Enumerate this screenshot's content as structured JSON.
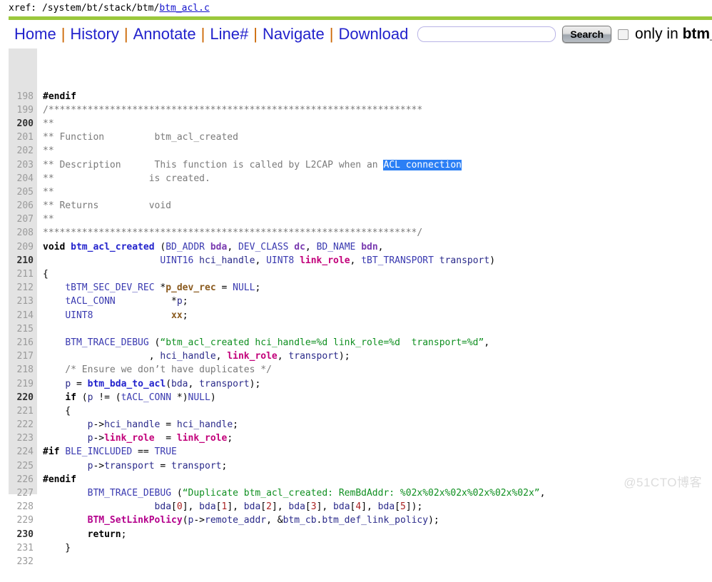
{
  "xref": {
    "label": "xref:",
    "path_plain": "/system/bt/stack/btm/",
    "path_link": "btm_acl.c"
  },
  "nav": {
    "links": [
      {
        "label": "Home"
      },
      {
        "label": "History"
      },
      {
        "label": "Annotate"
      },
      {
        "label": "Line#"
      },
      {
        "label": "Navigate"
      },
      {
        "label": "Download"
      }
    ],
    "separator": "|",
    "search_value": "",
    "search_placeholder": "",
    "search_button_label": "Search",
    "only_in_prefix": "only in ",
    "only_in_scope": "btm_",
    "checkbox_checked": false
  },
  "colors": {
    "green_bar": "#9bc83c",
    "nav_link": "#2222cc",
    "nav_separator": "#cc6600",
    "gutter_bg": "#e3e3e3",
    "selection_bg": "#2b7ff5",
    "string": "#0f8f20",
    "comment": "#7a7a7a",
    "function_blue": "#2222cc",
    "function_magenta": "#b4008c",
    "number": "#aa2222"
  },
  "code": {
    "first_line": 198,
    "lines": [
      {
        "n": 198,
        "tokens": [
          {
            "t": "#endif",
            "c": "t-pre"
          }
        ]
      },
      {
        "n": 199,
        "tokens": [
          {
            "t": "/*******************************************************************",
            "c": "t-com"
          }
        ]
      },
      {
        "n": 200,
        "tokens": [
          {
            "t": "**",
            "c": "t-com"
          }
        ]
      },
      {
        "n": 201,
        "tokens": [
          {
            "t": "** Function         btm_acl_created",
            "c": "t-com"
          }
        ]
      },
      {
        "n": 202,
        "tokens": [
          {
            "t": "**",
            "c": "t-com"
          }
        ]
      },
      {
        "n": 203,
        "tokens": [
          {
            "t": "** Description      This function is called by L2CAP when an ",
            "c": "t-com"
          },
          {
            "t": "ACL connection",
            "c": "t-sel"
          }
        ]
      },
      {
        "n": 204,
        "tokens": [
          {
            "t": "**                 is created.",
            "c": "t-com"
          }
        ]
      },
      {
        "n": 205,
        "tokens": [
          {
            "t": "**",
            "c": "t-com"
          }
        ]
      },
      {
        "n": 206,
        "tokens": [
          {
            "t": "** Returns         void",
            "c": "t-com"
          }
        ]
      },
      {
        "n": 207,
        "tokens": [
          {
            "t": "**",
            "c": "t-com"
          }
        ]
      },
      {
        "n": 208,
        "tokens": [
          {
            "t": "*******************************************************************/",
            "c": "t-com"
          }
        ]
      },
      {
        "n": 209,
        "tokens": [
          {
            "t": "void",
            "c": "t-kw"
          },
          {
            "t": " ",
            "c": ""
          },
          {
            "t": "btm_acl_created",
            "c": "t-fnblue"
          },
          {
            "t": " (",
            "c": ""
          },
          {
            "t": "BD_ADDR",
            "c": "t-type"
          },
          {
            "t": " ",
            "c": ""
          },
          {
            "t": "bda",
            "c": "t-var"
          },
          {
            "t": ", ",
            "c": ""
          },
          {
            "t": "DEV_CLASS",
            "c": "t-type"
          },
          {
            "t": " ",
            "c": ""
          },
          {
            "t": "dc",
            "c": "t-var"
          },
          {
            "t": ", ",
            "c": ""
          },
          {
            "t": "BD_NAME",
            "c": "t-type"
          },
          {
            "t": " ",
            "c": ""
          },
          {
            "t": "bdn",
            "c": "t-var"
          },
          {
            "t": ",",
            "c": ""
          }
        ]
      },
      {
        "n": 210,
        "tokens": [
          {
            "t": "                     ",
            "c": ""
          },
          {
            "t": "UINT16",
            "c": "t-type"
          },
          {
            "t": " ",
            "c": ""
          },
          {
            "t": "hci_handle",
            "c": "t-plain"
          },
          {
            "t": ", ",
            "c": ""
          },
          {
            "t": "UINT8",
            "c": "t-type"
          },
          {
            "t": " ",
            "c": ""
          },
          {
            "t": "link_role",
            "c": "t-varm"
          },
          {
            "t": ", ",
            "c": ""
          },
          {
            "t": "tBT_TRANSPORT",
            "c": "t-type"
          },
          {
            "t": " ",
            "c": ""
          },
          {
            "t": "transport",
            "c": "t-plain"
          },
          {
            "t": ")",
            "c": ""
          }
        ]
      },
      {
        "n": 211,
        "tokens": [
          {
            "t": "{",
            "c": ""
          }
        ]
      },
      {
        "n": 212,
        "tokens": [
          {
            "t": "    ",
            "c": ""
          },
          {
            "t": "tBTM_SEC_DEV_REC",
            "c": "t-type"
          },
          {
            "t": " *",
            "c": ""
          },
          {
            "t": "p_dev_rec",
            "c": "t-var2"
          },
          {
            "t": " = ",
            "c": ""
          },
          {
            "t": "NULL",
            "c": "t-type"
          },
          {
            "t": ";",
            "c": ""
          }
        ]
      },
      {
        "n": 213,
        "tokens": [
          {
            "t": "    ",
            "c": ""
          },
          {
            "t": "tACL_CONN",
            "c": "t-type"
          },
          {
            "t": "          *",
            "c": ""
          },
          {
            "t": "p",
            "c": "t-plain"
          },
          {
            "t": ";",
            "c": ""
          }
        ]
      },
      {
        "n": 214,
        "tokens": [
          {
            "t": "    ",
            "c": ""
          },
          {
            "t": "UINT8",
            "c": "t-type"
          },
          {
            "t": "              ",
            "c": ""
          },
          {
            "t": "xx",
            "c": "t-var2"
          },
          {
            "t": ";",
            "c": ""
          }
        ]
      },
      {
        "n": 215,
        "tokens": [
          {
            "t": "",
            "c": ""
          }
        ]
      },
      {
        "n": 216,
        "tokens": [
          {
            "t": "    ",
            "c": ""
          },
          {
            "t": "BTM_TRACE_DEBUG",
            "c": "t-type"
          },
          {
            "t": " (",
            "c": ""
          },
          {
            "t": "“btm_acl_created hci_handle=%d link_role=%d  transport=%d”",
            "c": "t-str"
          },
          {
            "t": ",",
            "c": ""
          }
        ]
      },
      {
        "n": 217,
        "tokens": [
          {
            "t": "                   , ",
            "c": ""
          },
          {
            "t": "hci_handle",
            "c": "t-plain"
          },
          {
            "t": ", ",
            "c": ""
          },
          {
            "t": "link_role",
            "c": "t-varm"
          },
          {
            "t": ", ",
            "c": ""
          },
          {
            "t": "transport",
            "c": "t-plain"
          },
          {
            "t": ");",
            "c": ""
          }
        ]
      },
      {
        "n": 218,
        "tokens": [
          {
            "t": "    /* Ensure we don’t have duplicates */",
            "c": "t-com"
          }
        ]
      },
      {
        "n": 219,
        "tokens": [
          {
            "t": "    ",
            "c": ""
          },
          {
            "t": "p",
            "c": "t-plain"
          },
          {
            "t": " = ",
            "c": ""
          },
          {
            "t": "btm_bda_to_acl",
            "c": "t-fnblue"
          },
          {
            "t": "(",
            "c": ""
          },
          {
            "t": "bda",
            "c": "t-plain"
          },
          {
            "t": ", ",
            "c": ""
          },
          {
            "t": "transport",
            "c": "t-plain"
          },
          {
            "t": ");",
            "c": ""
          }
        ]
      },
      {
        "n": 220,
        "tokens": [
          {
            "t": "    ",
            "c": ""
          },
          {
            "t": "if",
            "c": "t-kw"
          },
          {
            "t": " (",
            "c": ""
          },
          {
            "t": "p",
            "c": "t-plain"
          },
          {
            "t": " != (",
            "c": ""
          },
          {
            "t": "tACL_CONN",
            "c": "t-type"
          },
          {
            "t": " *)",
            "c": ""
          },
          {
            "t": "NULL",
            "c": "t-type"
          },
          {
            "t": ")",
            "c": ""
          }
        ]
      },
      {
        "n": 221,
        "tokens": [
          {
            "t": "    {",
            "c": ""
          }
        ]
      },
      {
        "n": 222,
        "tokens": [
          {
            "t": "        ",
            "c": ""
          },
          {
            "t": "p",
            "c": "t-plain"
          },
          {
            "t": "->",
            "c": ""
          },
          {
            "t": "hci_handle",
            "c": "t-plain"
          },
          {
            "t": " = ",
            "c": ""
          },
          {
            "t": "hci_handle",
            "c": "t-plain"
          },
          {
            "t": ";",
            "c": ""
          }
        ]
      },
      {
        "n": 223,
        "tokens": [
          {
            "t": "        ",
            "c": ""
          },
          {
            "t": "p",
            "c": "t-plain"
          },
          {
            "t": "->",
            "c": ""
          },
          {
            "t": "link_role",
            "c": "t-varm"
          },
          {
            "t": "  = ",
            "c": ""
          },
          {
            "t": "link_role",
            "c": "t-varm"
          },
          {
            "t": ";",
            "c": ""
          }
        ]
      },
      {
        "n": 224,
        "tokens": [
          {
            "t": "#if",
            "c": "t-pre"
          },
          {
            "t": " ",
            "c": ""
          },
          {
            "t": "BLE_INCLUDED",
            "c": "t-type"
          },
          {
            "t": " == ",
            "c": ""
          },
          {
            "t": "TRUE",
            "c": "t-type"
          }
        ]
      },
      {
        "n": 225,
        "tokens": [
          {
            "t": "        ",
            "c": ""
          },
          {
            "t": "p",
            "c": "t-plain"
          },
          {
            "t": "->",
            "c": ""
          },
          {
            "t": "transport",
            "c": "t-plain"
          },
          {
            "t": " = ",
            "c": ""
          },
          {
            "t": "transport",
            "c": "t-plain"
          },
          {
            "t": ";",
            "c": ""
          }
        ]
      },
      {
        "n": 226,
        "tokens": [
          {
            "t": "#endif",
            "c": "t-pre"
          }
        ]
      },
      {
        "n": 227,
        "tokens": [
          {
            "t": "        ",
            "c": ""
          },
          {
            "t": "BTM_TRACE_DEBUG",
            "c": "t-type"
          },
          {
            "t": " (",
            "c": ""
          },
          {
            "t": "“Duplicate btm_acl_created: RemBdAddr: %02x%02x%02x%02x%02x%02x”",
            "c": "t-str"
          },
          {
            "t": ",",
            "c": ""
          }
        ]
      },
      {
        "n": 228,
        "tokens": [
          {
            "t": "                    ",
            "c": ""
          },
          {
            "t": "bda",
            "c": "t-plain"
          },
          {
            "t": "[",
            "c": ""
          },
          {
            "t": "0",
            "c": "t-num"
          },
          {
            "t": "], ",
            "c": ""
          },
          {
            "t": "bda",
            "c": "t-plain"
          },
          {
            "t": "[",
            "c": ""
          },
          {
            "t": "1",
            "c": "t-num"
          },
          {
            "t": "], ",
            "c": ""
          },
          {
            "t": "bda",
            "c": "t-plain"
          },
          {
            "t": "[",
            "c": ""
          },
          {
            "t": "2",
            "c": "t-num"
          },
          {
            "t": "], ",
            "c": ""
          },
          {
            "t": "bda",
            "c": "t-plain"
          },
          {
            "t": "[",
            "c": ""
          },
          {
            "t": "3",
            "c": "t-num"
          },
          {
            "t": "], ",
            "c": ""
          },
          {
            "t": "bda",
            "c": "t-plain"
          },
          {
            "t": "[",
            "c": ""
          },
          {
            "t": "4",
            "c": "t-num"
          },
          {
            "t": "], ",
            "c": ""
          },
          {
            "t": "bda",
            "c": "t-plain"
          },
          {
            "t": "[",
            "c": ""
          },
          {
            "t": "5",
            "c": "t-num"
          },
          {
            "t": "]);",
            "c": ""
          }
        ]
      },
      {
        "n": 229,
        "tokens": [
          {
            "t": "        ",
            "c": ""
          },
          {
            "t": "BTM_SetLinkPolicy",
            "c": "t-fnmag"
          },
          {
            "t": "(",
            "c": ""
          },
          {
            "t": "p",
            "c": "t-plain"
          },
          {
            "t": "->",
            "c": ""
          },
          {
            "t": "remote_addr",
            "c": "t-plain"
          },
          {
            "t": ", &",
            "c": ""
          },
          {
            "t": "btm_cb",
            "c": "t-plain"
          },
          {
            "t": ".",
            "c": ""
          },
          {
            "t": "btm_def_link_policy",
            "c": "t-plain"
          },
          {
            "t": ");",
            "c": ""
          }
        ]
      },
      {
        "n": 230,
        "tokens": [
          {
            "t": "        ",
            "c": ""
          },
          {
            "t": "return",
            "c": "t-kw"
          },
          {
            "t": ";",
            "c": ""
          }
        ]
      },
      {
        "n": 231,
        "tokens": [
          {
            "t": "    }",
            "c": ""
          }
        ]
      },
      {
        "n": 232,
        "tokens": [
          {
            "t": "",
            "c": ""
          }
        ]
      }
    ]
  },
  "watermark": {
    "text": "@51CTO博客"
  }
}
